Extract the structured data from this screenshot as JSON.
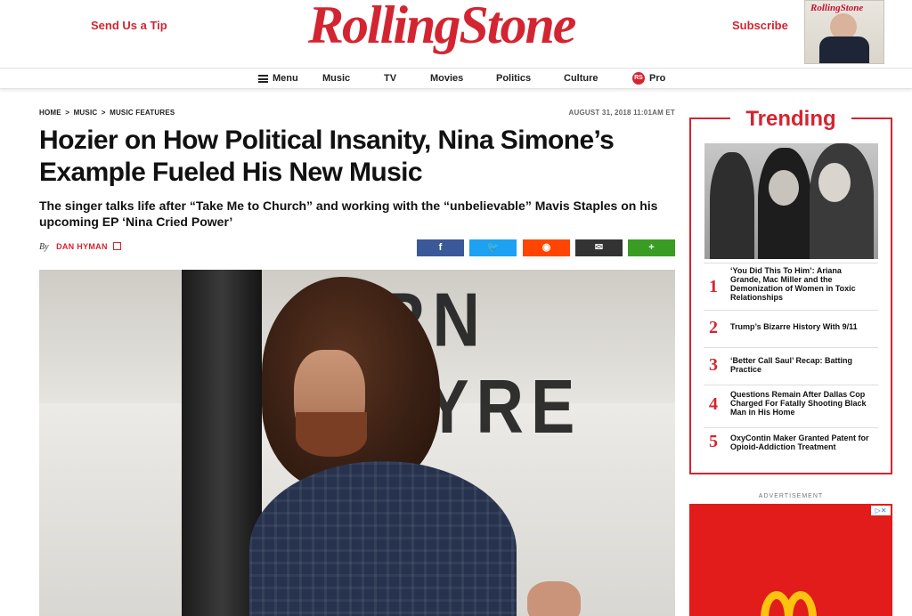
{
  "header": {
    "tip_label": "Send Us a Tip",
    "logo": "RollingStone",
    "subscribe_label": "Subscribe",
    "cover_title": "RollingStone",
    "cover_lines": ""
  },
  "nav": {
    "menu_label": "Menu",
    "items": [
      "Music",
      "TV",
      "Movies",
      "Politics",
      "Culture"
    ],
    "pro_label": "Pro",
    "pro_icon": "RS"
  },
  "article": {
    "breadcrumb": [
      "HOME",
      ">",
      "MUSIC",
      ">",
      "MUSIC FEATURES"
    ],
    "date": "AUGUST 31, 2018 11:01AM ET",
    "headline": "Hozier on How Political Insanity, Nina Simone’s Example Fueled His New Music",
    "dek": "The singer talks life after “Take Me to Church” and working with the “unbelievable” Mavis Staples on his upcoming EP ‘Nina Cried Power’",
    "by": "By",
    "author": "DAN HYMAN",
    "hero_sign_text": "RN TYRE"
  },
  "share": {
    "facebook": "f",
    "twitter": "🐦",
    "reddit": "◉",
    "email": "✉",
    "more": "+",
    "colors": {
      "facebook": "#3b5998",
      "twitter": "#1da1f2",
      "reddit": "#ff4500",
      "email": "#333333",
      "more": "#3a9d23"
    }
  },
  "trending": {
    "title": "Trending",
    "items": [
      {
        "num": "1",
        "text": "‘You Did This To Him’: Ariana Grande, Mac Miller and the Demonization of Women in Toxic Relationships"
      },
      {
        "num": "2",
        "text": "Trump’s Bizarre History With 9/11"
      },
      {
        "num": "3",
        "text": "‘Better Call Saul’ Recap: Batting Practice"
      },
      {
        "num": "4",
        "text": "Questions Remain After Dallas Cop Charged For Fatally Shooting Black Man in His Home"
      },
      {
        "num": "5",
        "text": "OxyContin Maker Granted Patent for Opioid-Addiction Treatment"
      }
    ]
  },
  "ad": {
    "label": "ADVERTISEMENT",
    "choice": "▷✕"
  },
  "colors": {
    "brand_red": "#d32531"
  }
}
